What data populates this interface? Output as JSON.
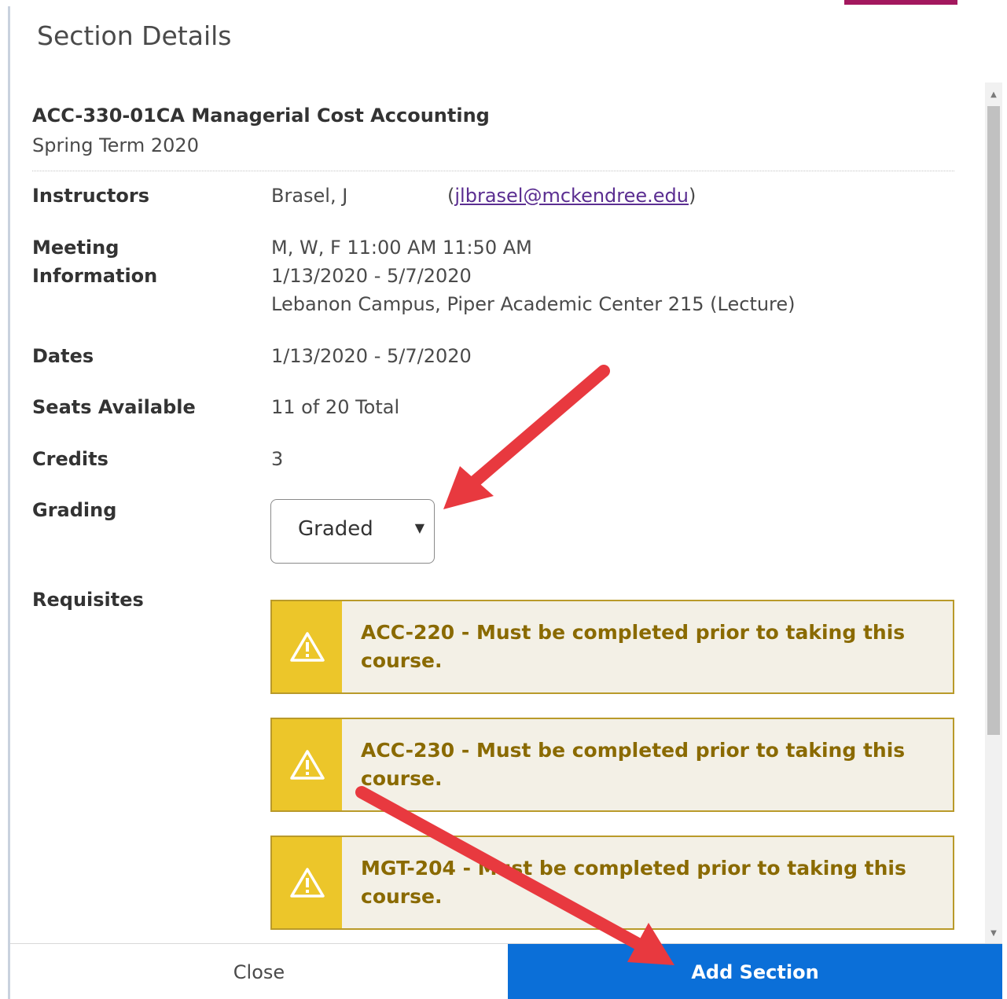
{
  "dialog": {
    "title": "Section Details"
  },
  "section": {
    "course_title": "ACC-330-01CA Managerial Cost Accounting",
    "term": "Spring Term 2020"
  },
  "details": {
    "instructors_label": "Instructors",
    "instructor_name": "Brasel, J",
    "instructor_email_open": "(",
    "instructor_email": "jlbrasel@mckendree.edu",
    "instructor_email_close": ")",
    "meeting_label_line1": "Meeting",
    "meeting_label_line2": "Information",
    "meeting_times": "M, W, F 11:00 AM 11:50 AM",
    "meeting_dates": "1/13/2020 - 5/7/2020",
    "meeting_location": "Lebanon Campus, Piper Academic Center 215 (Lecture)",
    "dates_label": "Dates",
    "dates_value": "1/13/2020 - 5/7/2020",
    "seats_label": "Seats Available",
    "seats_value": "11 of 20 Total",
    "credits_label": "Credits",
    "credits_value": "3",
    "grading_label": "Grading",
    "grading_selected": "Graded",
    "requisites_label": "Requisites"
  },
  "requisites": [
    {
      "text": "ACC-220 - Must be completed prior to taking this course.",
      "icon": "warning-icon"
    },
    {
      "text": "ACC-230 - Must be completed prior to taking this course.",
      "icon": "warning-icon"
    },
    {
      "text": "MGT-204 - Must be completed prior to taking this course.",
      "icon": "warning-icon"
    }
  ],
  "footer": {
    "close_label": "Close",
    "add_label": "Add Section"
  },
  "colors": {
    "primary_button": "#0b6fd8",
    "warning_accent": "#ecc62a",
    "warning_text": "#8a6a00",
    "annotation_arrow": "#e8393f",
    "top_accent": "#a3185e"
  }
}
